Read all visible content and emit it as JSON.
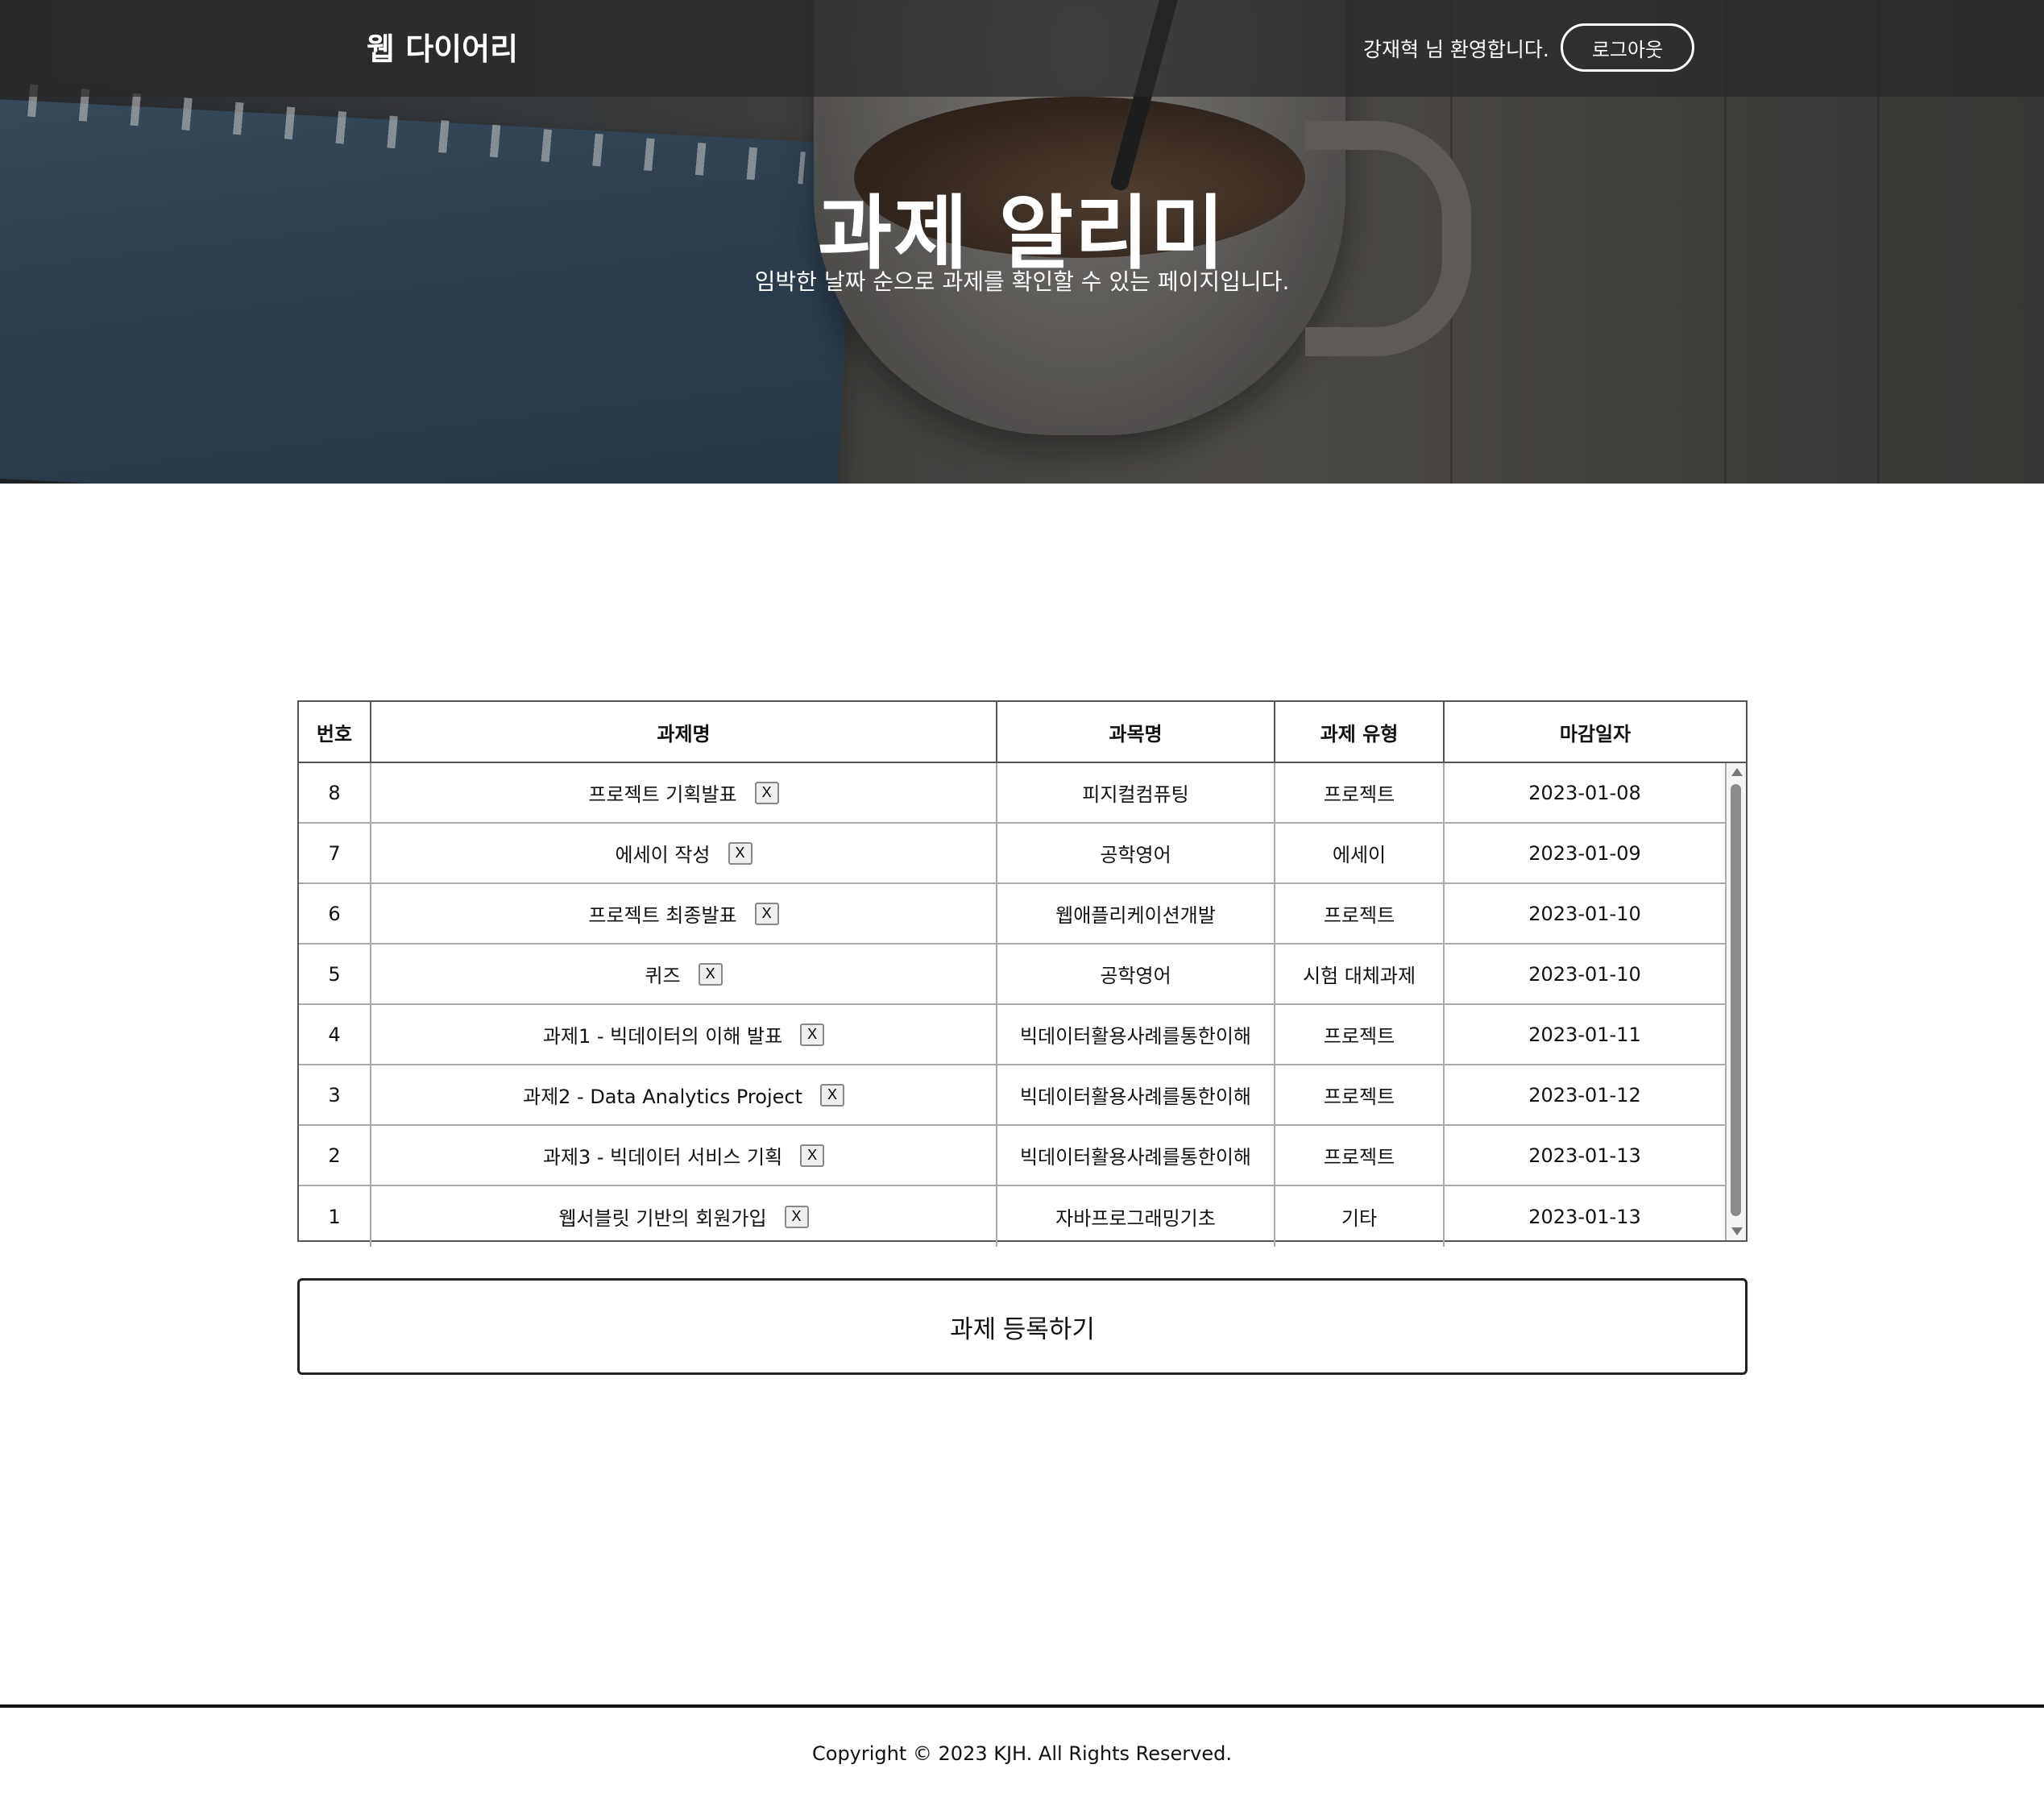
{
  "header": {
    "brand": "웹 다이어리",
    "welcome": "강재혁 님 환영합니다.",
    "logout_label": "로그아웃"
  },
  "hero": {
    "title": "과제 알리미",
    "subtitle": "임박한 날짜 순으로 과제를 확인할 수 있는 페이지입니다."
  },
  "table": {
    "columns": [
      "번호",
      "과제명",
      "과목명",
      "과제 유형",
      "마감일자"
    ],
    "delete_label": "X",
    "rows": [
      {
        "no": "8",
        "name": "프로젝트 기획발표",
        "subject": "피지컬컴퓨팅",
        "type": "프로젝트",
        "due": "2023-01-08"
      },
      {
        "no": "7",
        "name": "에세이 작성",
        "subject": "공학영어",
        "type": "에세이",
        "due": "2023-01-09"
      },
      {
        "no": "6",
        "name": "프로젝트 최종발표",
        "subject": "웹애플리케이션개발",
        "type": "프로젝트",
        "due": "2023-01-10"
      },
      {
        "no": "5",
        "name": "퀴즈",
        "subject": "공학영어",
        "type": "시험 대체과제",
        "due": "2023-01-10"
      },
      {
        "no": "4",
        "name": "과제1 - 빅데이터의 이해 발표",
        "subject": "빅데이터활용사례를통한이해",
        "type": "프로젝트",
        "due": "2023-01-11"
      },
      {
        "no": "3",
        "name": "과제2 - Data Analytics Project",
        "subject": "빅데이터활용사례를통한이해",
        "type": "프로젝트",
        "due": "2023-01-12"
      },
      {
        "no": "2",
        "name": "과제3 - 빅데이터 서비스 기획",
        "subject": "빅데이터활용사례를통한이해",
        "type": "프로젝트",
        "due": "2023-01-13"
      },
      {
        "no": "1",
        "name": "웹서블릿 기반의 회원가입",
        "subject": "자바프로그래밍기초",
        "type": "기타",
        "due": "2023-01-13"
      }
    ]
  },
  "add_button_label": "과제 등록하기",
  "footer": {
    "copyright": "Copyright © 2023 KJH. All Rights Reserved."
  }
}
